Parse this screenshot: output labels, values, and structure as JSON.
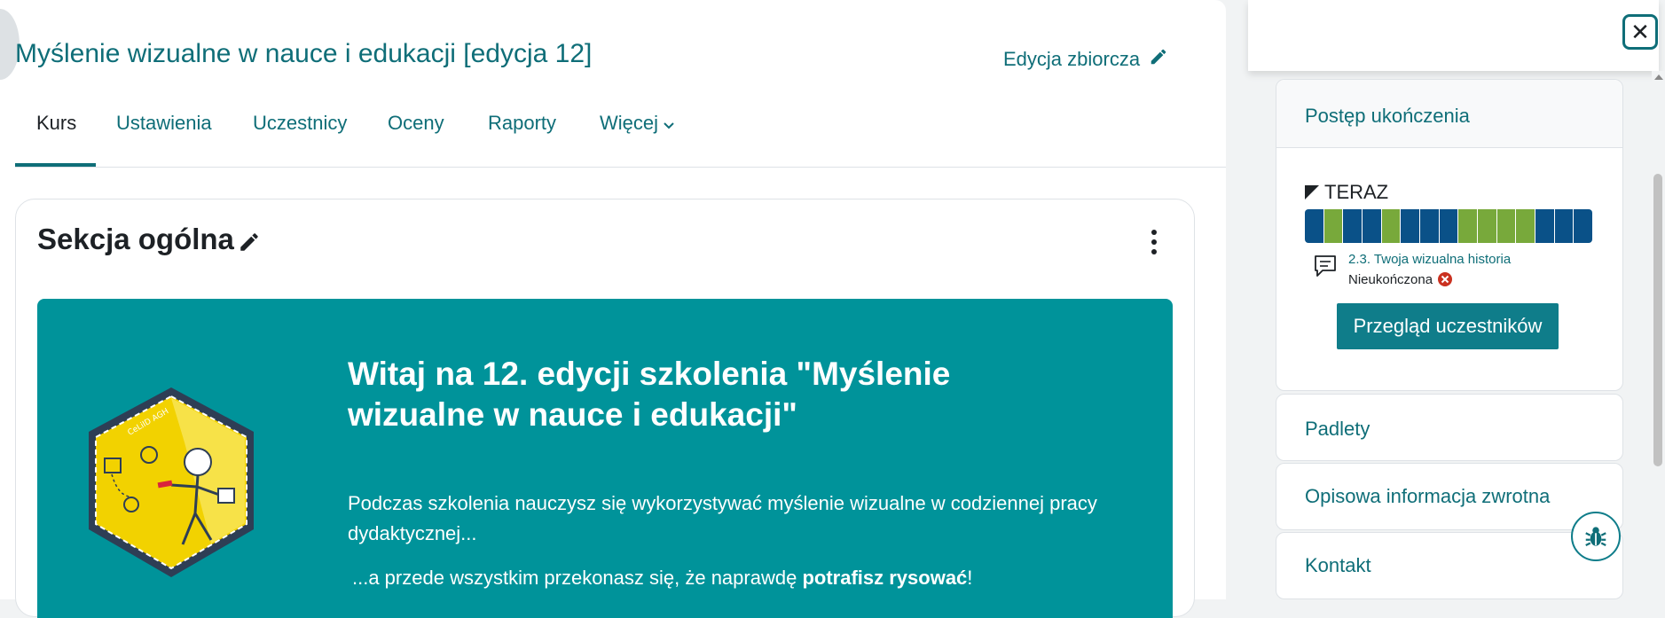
{
  "course": {
    "title": "Myślenie wizualne w nauce i edukacji [edycja 12]",
    "bulk_edit_label": "Edycja zbiorcza"
  },
  "nav": {
    "tabs": [
      {
        "label": "Kurs",
        "active": true
      },
      {
        "label": "Ustawienia"
      },
      {
        "label": "Uczestnicy"
      },
      {
        "label": "Oceny"
      },
      {
        "label": "Raporty"
      },
      {
        "label": "Więcej"
      }
    ]
  },
  "section": {
    "title": "Sekcja ogólna"
  },
  "banner": {
    "heading": "Witaj na 12. edycji szkolenia \"Myślenie wizualne w nauce i edukacji\"",
    "paragraph1": "Podczas szkolenia nauczysz się wykorzystywać myślenie wizualne w codziennej pracy dydaktycznej...",
    "paragraph2_prefix": "...a przede wszystkim przekonasz się, że naprawdę ",
    "paragraph2_bold": "potrafisz rysować",
    "paragraph2_suffix": "!",
    "badge_text": "CeLiID AGH"
  },
  "drawer": {
    "blocks": {
      "progress": {
        "title": "Postęp ukończenia",
        "now_label": "TERAZ",
        "segments": [
          "blue",
          "green",
          "blue",
          "blue",
          "green",
          "blue",
          "blue",
          "blue",
          "green",
          "green",
          "green",
          "green",
          "blue",
          "blue",
          "blue"
        ],
        "activity_link": "2.3. Twoja wizualna historia",
        "activity_status": "Nieukończona",
        "overview_button": "Przegląd uczestników"
      },
      "padlety": {
        "title": "Padlety"
      },
      "feedback": {
        "title": "Opisowa informacja zwrotna"
      },
      "kontakt": {
        "title": "Kontakt"
      }
    }
  },
  "colors": {
    "accent": "#0f6e78",
    "banner": "#00939a",
    "progress_blue": "#0a5188",
    "progress_green": "#78a93b",
    "error_red": "#ca3120"
  },
  "icons": {
    "edit": "pencil-icon",
    "more": "kebab-icon",
    "close": "close-icon",
    "bug": "bug-icon",
    "forum": "chat-icon"
  }
}
